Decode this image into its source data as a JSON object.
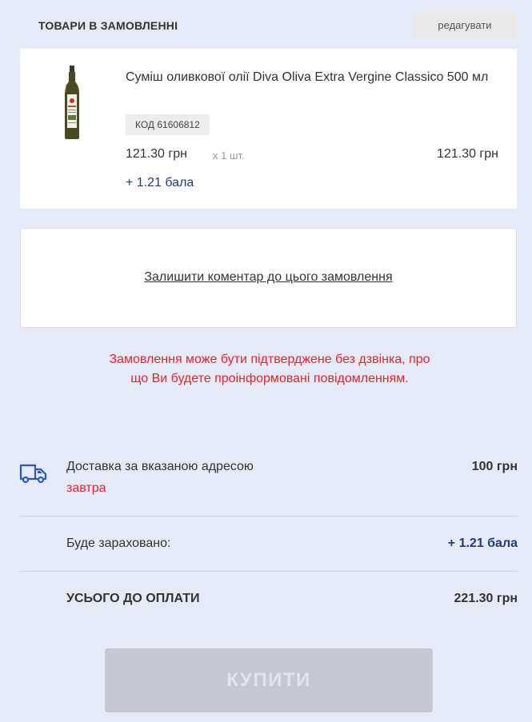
{
  "header": {
    "title": "ТОВАРИ В ЗАМОВЛЕННІ",
    "edit_label": "редагувати"
  },
  "product": {
    "image_icon": "olive-oil-bottle-icon",
    "name": "Суміш оливкової олії Diva Oliva Extra Vergine Classico 500 мл",
    "code": "КОД 61606812",
    "price": "121.30 грн",
    "quantity": "х 1 шт.",
    "total": "121.30 грн",
    "bonus": "+ 1.21 бала"
  },
  "comment": {
    "link_label": "Залишити коментар до цього замовлення"
  },
  "notice": {
    "text": "Замовлення може бути підтверджене без дзвінка, про що Ви будете проінформовані повідомленням."
  },
  "summary": {
    "delivery_icon": "truck-icon",
    "delivery_label": "Доставка за вказаною адресою",
    "delivery_when": "завтра",
    "delivery_price": "100 грн",
    "bonus_label": "Буде зараховано:",
    "bonus_value": "+ 1.21 бала",
    "total_label": "УСЬОГО ДО ОПЛАТИ",
    "total_value": "221.30 грн"
  },
  "buy_button": {
    "label": "КУПИТИ"
  },
  "colors": {
    "background": "#e6e9f6",
    "accent_blue": "#1e3c82",
    "warning_red": "#e8232d",
    "disabled_button": "#c5c8d3"
  }
}
